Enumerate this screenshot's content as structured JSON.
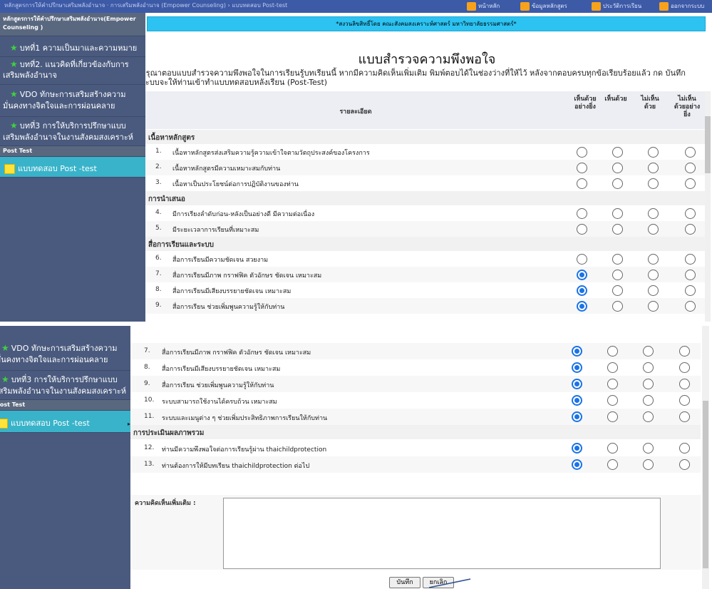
{
  "top": {
    "breadcrumb": "หลักสูตรการให้คำปรึกษาเสริมพลังอำนาจ · การเสริมพลังอำนาจ (Empower Counseling) › แบบทดสอบ Post-test",
    "buttons": [
      "หน้าหลัก",
      "ข้อมูลหลักสูตร",
      "ประวัติการเรียน",
      "ออกจากระบบ"
    ]
  },
  "sidebar": {
    "header": "หลักสูตรการให้คำปรึกษาเสริมพลังอำนาจ(Empower Counseling )",
    "items": [
      {
        "label": "บทที่1 ความเป็นมาและความหมาย"
      },
      {
        "label": "บทที่2. แนวคิดที่เกี่ยวข้องกับการเสริมพลังอำนาจ"
      },
      {
        "label": "VDO ทักษะการเสริมสร้างความมั่นคงทางจิตใจและการผ่อนคลาย"
      },
      {
        "label": "บทที่3 การให้บริการปรึกษาแบบเสริมพลังอำนาจในงานสังคมสงเคราะห์"
      }
    ],
    "post_test_header": "Post Test",
    "post_test_item": "แบบทดสอบ Post -test"
  },
  "banner": "*สงวนลิขสิทธิ์โดย คณะสังคมสงเคราะห์ศาสตร์ มหาวิทยาลัยธรรมศาสตร์*",
  "survey": {
    "title": "แบบสำรวจความพึงพอใจ",
    "intro": "กรุณาตอบแบบสำรวจความพึงพอใจในการเรียนรู้บทเรียนนี้ หากมีความคิดเห็นเพิ่มเติม พิมพ์ตอบได้ในช่องว่างที่ให้ไว้ หลังจากตอบครบทุกข้อเรียบร้อยแล้ว กด บันทึก ระบบจะให้ท่านเข้าทำแบบทดสอบหลังเรียน (Post-Test)",
    "header_detail": "รายละเอียด",
    "columns": [
      "เห็นด้วยอย่างยิ่ง",
      "เห็นด้วย",
      "ไม่เห็นด้วย",
      "ไม่เห็นด้วยอย่างยิ่ง"
    ],
    "sections": [
      {
        "title": "เนื้อหาหลักสูตร",
        "questions": [
          {
            "n": "1.",
            "text": "เนื้อหาหลักสูตรส่งเสริมความรู้ความเข้าใจตามวัตถุประสงค์ของโครงการ"
          },
          {
            "n": "2.",
            "text": "เนื้อหาหลักสูตรมีความเหมาะสมกับท่าน"
          },
          {
            "n": "3.",
            "text": "เนื้อหาเป็นประโยชน์ต่อการปฏิบัติงานของท่าน"
          }
        ]
      },
      {
        "title": "การนำเสนอ",
        "questions": [
          {
            "n": "4.",
            "text": "มีการเรียงลำดับก่อน-หลังเป็นอย่างดี มีความต่อเนื่อง"
          },
          {
            "n": "5.",
            "text": "มีระยะเวลาการเรียนที่เหมาะสม"
          }
        ]
      },
      {
        "title": "สื่อการเรียนและระบบ",
        "questions": [
          {
            "n": "6.",
            "text": "สื่อการเรียนมีความชัดเจน สวยงาม"
          },
          {
            "n": "7.",
            "text": "สื่อการเรียนมีภาพ กราฟฟิค ตัวอักษร ชัดเจน เหมาะสม"
          },
          {
            "n": "8.",
            "text": "สื่อการเรียนมีเสียงบรรยายชัดเจน เหมาะสม"
          },
          {
            "n": "9.",
            "text": "สื่อการเรียน ช่วยเพิ่มพูนความรู้ให้กับท่าน"
          },
          {
            "n": "10.",
            "text": "ระบบสามารถใช้งานได้ครบถ้วน เหมาะสม"
          },
          {
            "n": "11.",
            "text": "ระบบและเมนูต่าง ๆ ช่วยเพิ่มประสิทธิภาพการเรียนให้กับท่าน"
          }
        ]
      },
      {
        "title": "การประเมินผลภาพรวม",
        "questions": [
          {
            "n": "12.",
            "text": "ท่านมีความพึงพอใจต่อการเรียนรู้ผ่าน thaichildprotection"
          },
          {
            "n": "13.",
            "text": "ท่านต้องการให้มีบทเรียน thaichildprotection ต่อไป"
          }
        ]
      }
    ],
    "selected": {
      "7": 0,
      "8": 0,
      "9": 0,
      "10": 0,
      "11": 0,
      "12": 0,
      "13": 0
    },
    "comment_label": "ความคิดเห็นเพิ่มเติม :",
    "comment_value": "",
    "save_label": "บันทึก",
    "cancel_label": "ยกเลิก"
  },
  "colors": {
    "banner": "#2cc3f2",
    "sidebar": "#4a5a7e",
    "post_test": "#39b3c9",
    "radio_selected": "#1a73e8",
    "star_icon": "#3fd13f"
  }
}
